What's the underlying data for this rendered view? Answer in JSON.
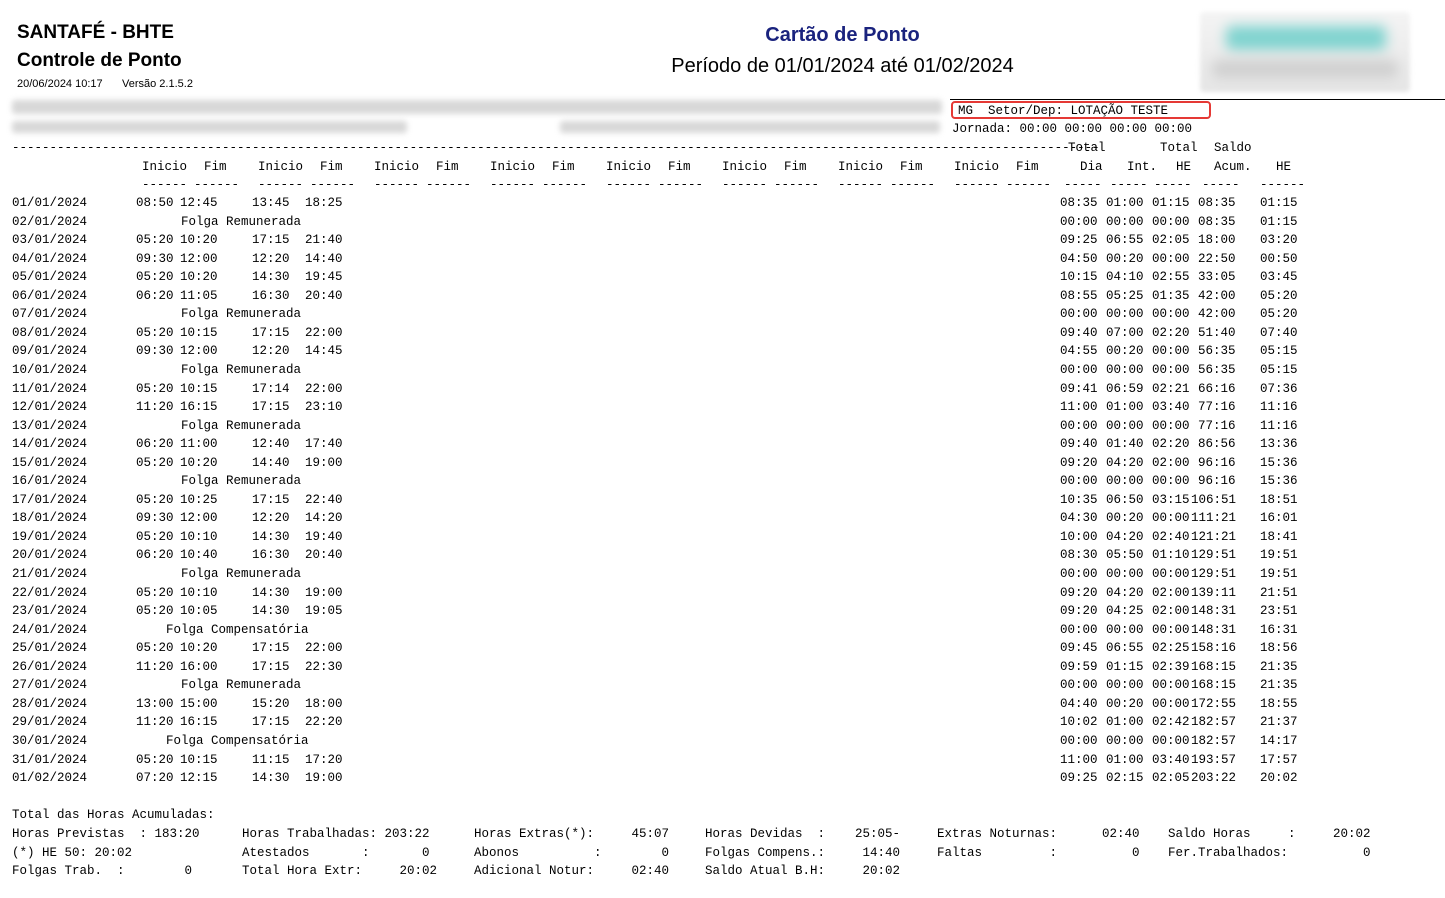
{
  "header": {
    "company": "SANTAFÉ - BHTE",
    "report_name": "Controle de Ponto",
    "print_date": "20/06/2024 10:17",
    "version": "Versão 2.1.5.2",
    "title": "Cartão de Ponto",
    "period": "Período de 01/01/2024 até 01/02/2024",
    "sector": "MG  Setor/Dep: LOTAÇÃO TESTE",
    "jornada": "Jornada: 00:00 00:00 00:00 00:00"
  },
  "columns": {
    "total_label": "Total",
    "total2_label": "Total",
    "saldo_label": "Saldo",
    "pairs": [
      {
        "start": "Inicio",
        "end": "Fim"
      },
      {
        "start": "Inicio",
        "end": "Fim"
      },
      {
        "start": "Inicio",
        "end": "Fim"
      },
      {
        "start": "Inicio",
        "end": "Fim"
      },
      {
        "start": "Inicio",
        "end": "Fim"
      },
      {
        "start": "Inicio",
        "end": "Fim"
      },
      {
        "start": "Inicio",
        "end": "Fim"
      },
      {
        "start": "Inicio",
        "end": "Fim"
      }
    ],
    "dia": "Dia",
    "int": "Int.",
    "he": "HE",
    "acum": "Acum.",
    "he2": "HE"
  },
  "rows": [
    {
      "date": "01/01/2024",
      "times": [
        "08:50",
        "12:45",
        "13:45",
        "18:25"
      ],
      "note": "",
      "dia": "08:35",
      "int": "01:00",
      "he": "01:15",
      "acum": "08:35",
      "he2": "01:15"
    },
    {
      "date": "02/01/2024",
      "times": [],
      "note": "Folga Remunerada",
      "dia": "00:00",
      "int": "00:00",
      "he": "00:00",
      "acum": "08:35",
      "he2": "01:15"
    },
    {
      "date": "03/01/2024",
      "times": [
        "05:20",
        "10:20",
        "17:15",
        "21:40"
      ],
      "note": "",
      "dia": "09:25",
      "int": "06:55",
      "he": "02:05",
      "acum": "18:00",
      "he2": "03:20"
    },
    {
      "date": "04/01/2024",
      "times": [
        "09:30",
        "12:00",
        "12:20",
        "14:40"
      ],
      "note": "",
      "dia": "04:50",
      "int": "00:20",
      "he": "00:00",
      "acum": "22:50",
      "he2": "00:50"
    },
    {
      "date": "05/01/2024",
      "times": [
        "05:20",
        "10:20",
        "14:30",
        "19:45"
      ],
      "note": "",
      "dia": "10:15",
      "int": "04:10",
      "he": "02:55",
      "acum": "33:05",
      "he2": "03:45"
    },
    {
      "date": "06/01/2024",
      "times": [
        "06:20",
        "11:05",
        "16:30",
        "20:40"
      ],
      "note": "",
      "dia": "08:55",
      "int": "05:25",
      "he": "01:35",
      "acum": "42:00",
      "he2": "05:20"
    },
    {
      "date": "07/01/2024",
      "times": [],
      "note": "Folga Remunerada",
      "dia": "00:00",
      "int": "00:00",
      "he": "00:00",
      "acum": "42:00",
      "he2": "05:20"
    },
    {
      "date": "08/01/2024",
      "times": [
        "05:20",
        "10:15",
        "17:15",
        "22:00"
      ],
      "note": "",
      "dia": "09:40",
      "int": "07:00",
      "he": "02:20",
      "acum": "51:40",
      "he2": "07:40"
    },
    {
      "date": "09/01/2024",
      "times": [
        "09:30",
        "12:00",
        "12:20",
        "14:45"
      ],
      "note": "",
      "dia": "04:55",
      "int": "00:20",
      "he": "00:00",
      "acum": "56:35",
      "he2": "05:15"
    },
    {
      "date": "10/01/2024",
      "times": [],
      "note": "Folga Remunerada",
      "dia": "00:00",
      "int": "00:00",
      "he": "00:00",
      "acum": "56:35",
      "he2": "05:15"
    },
    {
      "date": "11/01/2024",
      "times": [
        "05:20",
        "10:15",
        "17:14",
        "22:00"
      ],
      "note": "",
      "dia": "09:41",
      "int": "06:59",
      "he": "02:21",
      "acum": "66:16",
      "he2": "07:36"
    },
    {
      "date": "12/01/2024",
      "times": [
        "11:20",
        "16:15",
        "17:15",
        "23:10"
      ],
      "note": "",
      "dia": "11:00",
      "int": "01:00",
      "he": "03:40",
      "acum": "77:16",
      "he2": "11:16"
    },
    {
      "date": "13/01/2024",
      "times": [],
      "note": "Folga Remunerada",
      "dia": "00:00",
      "int": "00:00",
      "he": "00:00",
      "acum": "77:16",
      "he2": "11:16"
    },
    {
      "date": "14/01/2024",
      "times": [
        "06:20",
        "11:00",
        "12:40",
        "17:40"
      ],
      "note": "",
      "dia": "09:40",
      "int": "01:40",
      "he": "02:20",
      "acum": "86:56",
      "he2": "13:36"
    },
    {
      "date": "15/01/2024",
      "times": [
        "05:20",
        "10:20",
        "14:40",
        "19:00"
      ],
      "note": "",
      "dia": "09:20",
      "int": "04:20",
      "he": "02:00",
      "acum": "96:16",
      "he2": "15:36"
    },
    {
      "date": "16/01/2024",
      "times": [],
      "note": "Folga Remunerada",
      "dia": "00:00",
      "int": "00:00",
      "he": "00:00",
      "acum": "96:16",
      "he2": "15:36"
    },
    {
      "date": "17/01/2024",
      "times": [
        "05:20",
        "10:25",
        "17:15",
        "22:40"
      ],
      "note": "",
      "dia": "10:35",
      "int": "06:50",
      "he": "03:15",
      "acum": "106:51",
      "he2": "18:51"
    },
    {
      "date": "18/01/2024",
      "times": [
        "09:30",
        "12:00",
        "12:20",
        "14:20"
      ],
      "note": "",
      "dia": "04:30",
      "int": "00:20",
      "he": "00:00",
      "acum": "111:21",
      "he2": "16:01"
    },
    {
      "date": "19/01/2024",
      "times": [
        "05:20",
        "10:10",
        "14:30",
        "19:40"
      ],
      "note": "",
      "dia": "10:00",
      "int": "04:20",
      "he": "02:40",
      "acum": "121:21",
      "he2": "18:41"
    },
    {
      "date": "20/01/2024",
      "times": [
        "06:20",
        "10:40",
        "16:30",
        "20:40"
      ],
      "note": "",
      "dia": "08:30",
      "int": "05:50",
      "he": "01:10",
      "acum": "129:51",
      "he2": "19:51"
    },
    {
      "date": "21/01/2024",
      "times": [],
      "note": "Folga Remunerada",
      "dia": "00:00",
      "int": "00:00",
      "he": "00:00",
      "acum": "129:51",
      "he2": "19:51"
    },
    {
      "date": "22/01/2024",
      "times": [
        "05:20",
        "10:10",
        "14:30",
        "19:00"
      ],
      "note": "",
      "dia": "09:20",
      "int": "04:20",
      "he": "02:00",
      "acum": "139:11",
      "he2": "21:51"
    },
    {
      "date": "23/01/2024",
      "times": [
        "05:20",
        "10:05",
        "14:30",
        "19:05"
      ],
      "note": "",
      "dia": "09:20",
      "int": "04:25",
      "he": "02:00",
      "acum": "148:31",
      "he2": "23:51"
    },
    {
      "date": "24/01/2024",
      "times": [],
      "note": "Folga Compensatória",
      "dia": "00:00",
      "int": "00:00",
      "he": "00:00",
      "acum": "148:31",
      "he2": "16:31"
    },
    {
      "date": "25/01/2024",
      "times": [
        "05:20",
        "10:20",
        "17:15",
        "22:00"
      ],
      "note": "",
      "dia": "09:45",
      "int": "06:55",
      "he": "02:25",
      "acum": "158:16",
      "he2": "18:56"
    },
    {
      "date": "26/01/2024",
      "times": [
        "11:20",
        "16:00",
        "17:15",
        "22:30"
      ],
      "note": "",
      "dia": "09:59",
      "int": "01:15",
      "he": "02:39",
      "acum": "168:15",
      "he2": "21:35"
    },
    {
      "date": "27/01/2024",
      "times": [],
      "note": "Folga Remunerada",
      "dia": "00:00",
      "int": "00:00",
      "he": "00:00",
      "acum": "168:15",
      "he2": "21:35"
    },
    {
      "date": "28/01/2024",
      "times": [
        "13:00",
        "15:00",
        "15:20",
        "18:00"
      ],
      "note": "",
      "dia": "04:40",
      "int": "00:20",
      "he": "00:00",
      "acum": "172:55",
      "he2": "18:55"
    },
    {
      "date": "29/01/2024",
      "times": [
        "11:20",
        "16:15",
        "17:15",
        "22:20"
      ],
      "note": "",
      "dia": "10:02",
      "int": "01:00",
      "he": "02:42",
      "acum": "182:57",
      "he2": "21:37"
    },
    {
      "date": "30/01/2024",
      "times": [],
      "note": "Folga Compensatória",
      "dia": "00:00",
      "int": "00:00",
      "he": "00:00",
      "acum": "182:57",
      "he2": "14:17"
    },
    {
      "date": "31/01/2024",
      "times": [
        "05:20",
        "10:15",
        "11:15",
        "17:20"
      ],
      "note": "",
      "dia": "11:00",
      "int": "01:00",
      "he": "03:40",
      "acum": "193:57",
      "he2": "17:57"
    },
    {
      "date": "01/02/2024",
      "times": [
        "07:20",
        "12:15",
        "14:30",
        "19:00"
      ],
      "note": "",
      "dia": "09:25",
      "int": "02:15",
      "he": "02:05",
      "acum": "203:22",
      "he2": "20:02"
    }
  ],
  "totals": {
    "heading": "Total das Horas Acumuladas:",
    "lines": [
      [
        "Horas Previstas  : 183:20",
        "Horas Trabalhadas: 203:22",
        "Horas Extras(*):     45:07",
        "Horas Devidas  :    25:05-",
        "Extras Noturnas:      02:40",
        "Saldo Horas     :     20:02"
      ],
      [
        "(*) HE 50: 20:02",
        "Atestados       :       0",
        "Abonos          :        0",
        "Folgas Compens.:     14:40",
        "Faltas         :          0",
        "Fer.Trabalhados:          0"
      ],
      [
        "Folgas Trab.  :        0",
        "Total Hora Extr:     20:02",
        "Adicional Notur:     02:40",
        "Saldo Atual B.H:     20:02",
        "",
        ""
      ]
    ]
  }
}
